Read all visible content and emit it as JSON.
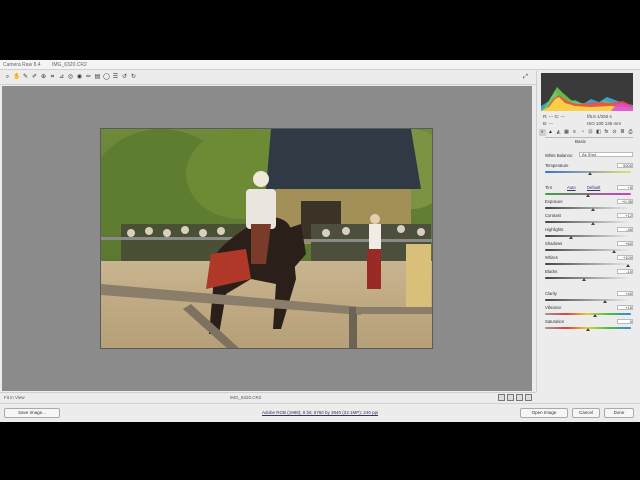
{
  "title": {
    "app_name": "Camera Raw 8.4",
    "file_info": "IMG_6320.CR2"
  },
  "toolbar": {
    "tools": [
      {
        "name": "zoom-tool",
        "glyph": "⌕"
      },
      {
        "name": "hand-tool",
        "glyph": "✋"
      },
      {
        "name": "white-balance-tool",
        "glyph": "✎"
      },
      {
        "name": "color-sampler-tool",
        "glyph": "✐"
      },
      {
        "name": "targeted-adjustment-tool",
        "glyph": "⊕"
      },
      {
        "name": "crop-tool",
        "glyph": "⌗"
      },
      {
        "name": "straighten-tool",
        "glyph": "⊿"
      },
      {
        "name": "spot-removal-tool",
        "glyph": "◎"
      },
      {
        "name": "red-eye-tool",
        "glyph": "◉"
      },
      {
        "name": "adjustment-brush-tool",
        "glyph": "✏"
      },
      {
        "name": "graduated-filter-tool",
        "glyph": "▤"
      },
      {
        "name": "radial-filter-tool",
        "glyph": "◯"
      },
      {
        "name": "preferences-tool",
        "glyph": "☰"
      },
      {
        "name": "rotate-left-tool",
        "glyph": "↺"
      },
      {
        "name": "rotate-right-tool",
        "glyph": "↻"
      }
    ],
    "fullscreen_glyph": "⤢"
  },
  "status": {
    "zoom": "Fit in View",
    "filename": "IMG_6320.CR2"
  },
  "bottom": {
    "save_button": "Save Image...",
    "workflow_link": "Adobe RGB (1998); 8 bit; 5760 by 3840 (22.1MP); 240 ppi",
    "open_button": "Open Image",
    "cancel_button": "Cancel",
    "done_button": "Done"
  },
  "panel": {
    "readout_left": "R: --- G: ---",
    "readout_right": "f/5.6  1/250 s",
    "readout_left2": "B: ---",
    "readout_right2": "ISO 100  135 mm",
    "tab_glyphs": [
      "◐",
      "▲",
      "◭",
      "▦",
      "≡",
      "◔",
      "⊡",
      "◧",
      "fx",
      "⊙",
      "≣",
      "⎙"
    ],
    "section_title": "Basic",
    "wb_label": "White Balance:",
    "wb_value": "As Shot",
    "auto_label": "Auto",
    "default_label": "Default",
    "sliders": [
      {
        "label": "Temperature",
        "value": "5200",
        "pos": 0.52,
        "track": "temp"
      },
      {
        "label": "Tint",
        "value": "+5",
        "pos": 0.5,
        "track": "tint"
      },
      {
        "label": "Exposure",
        "value": "+0.35",
        "pos": 0.56,
        "track": "gray"
      },
      {
        "label": "Contrast",
        "value": "+12",
        "pos": 0.56,
        "track": "gray"
      },
      {
        "label": "Highlights",
        "value": "-45",
        "pos": 0.3,
        "track": "gray"
      },
      {
        "label": "Shadows",
        "value": "+60",
        "pos": 0.8,
        "track": "gray"
      },
      {
        "label": "Whites",
        "value": "+100",
        "pos": 0.96,
        "track": "gray"
      },
      {
        "label": "Blacks",
        "value": "-10",
        "pos": 0.45,
        "track": "gray"
      },
      {
        "label": "Clarity",
        "value": "+40",
        "pos": 0.7,
        "track": "gray"
      },
      {
        "label": "Vibrance",
        "value": "+15",
        "pos": 0.58,
        "track": "sat"
      },
      {
        "label": "Saturation",
        "value": "0",
        "pos": 0.5,
        "track": "sat"
      }
    ]
  },
  "colors": {
    "canvas": "#8b8b8b",
    "panel": "#ececec",
    "histogram_bg": "#3a3a3a"
  }
}
